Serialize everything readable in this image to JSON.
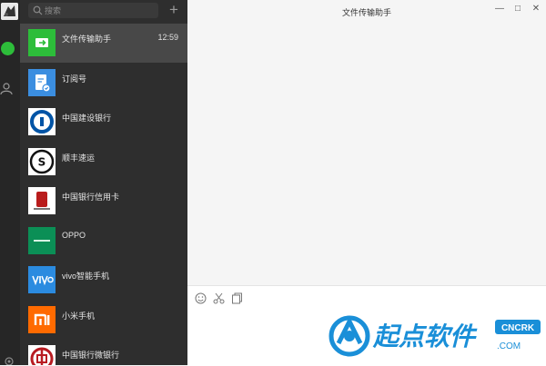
{
  "search": {
    "placeholder": "搜索"
  },
  "chats": [
    {
      "name": "文件传输助手",
      "time": "12:59",
      "icon": "file-transfer-icon",
      "color": "#2dbd3a",
      "active": true
    },
    {
      "name": "订阅号",
      "time": "",
      "icon": "subscription-icon",
      "color": "#3b8ee0"
    },
    {
      "name": "中国建设银行",
      "time": "",
      "icon": "ccb-logo-icon",
      "color": "#0054a6"
    },
    {
      "name": "顺丰速运",
      "time": "",
      "icon": "sf-logo-icon",
      "color": "#111111"
    },
    {
      "name": "中国银行信用卡",
      "time": "",
      "icon": "boc-seal-icon",
      "color": "#b91c1c"
    },
    {
      "name": "OPPO",
      "time": "",
      "icon": "oppo-logo-icon",
      "color": "#0b8f56"
    },
    {
      "name": "vivo智能手机",
      "time": "",
      "icon": "vivo-logo-icon",
      "color": "#2b8be0"
    },
    {
      "name": "小米手机",
      "time": "",
      "icon": "mi-logo-icon",
      "color": "#ff6a00"
    },
    {
      "name": "中国银行微银行",
      "time": "",
      "icon": "boc-logo-icon",
      "color": "#b81c22"
    }
  ],
  "main": {
    "title": "文件传输助手",
    "window_controls": [
      "—",
      "□",
      "✕"
    ],
    "tools": [
      "emoji-icon",
      "scissors-icon",
      "folder-icon"
    ]
  },
  "watermark": {
    "text": "起点软件",
    "badge": "CNCRK",
    "domain": ".COM"
  },
  "colors": {
    "rail": "#262626",
    "list": "#2e2e2e",
    "active_item": "#484848",
    "accent": "#2dbd3a"
  }
}
